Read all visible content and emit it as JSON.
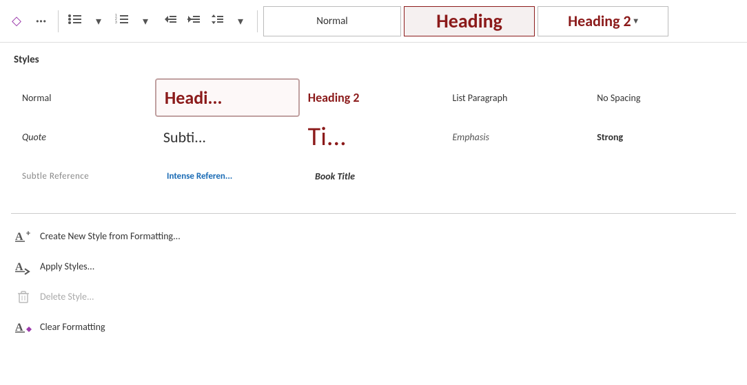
{
  "toolbar": {
    "diamond_icon": "◇",
    "more_icon": "•••",
    "bullet_list_icon": "≡",
    "num_list_icon": "≡",
    "outdent_icon": "⇤",
    "indent_icon": "⇥",
    "line_spacing_icon": "≡",
    "normal_label": "Normal",
    "heading1_label": "Heading",
    "heading2_label": "Heading 2",
    "dropdown_arrow": "▾"
  },
  "panel": {
    "title": "Styles",
    "styles": [
      {
        "id": "normal",
        "label": "Normal",
        "class": "sn-normal"
      },
      {
        "id": "heading1",
        "label": "Headi...",
        "class": "sn-heading1",
        "selected": true
      },
      {
        "id": "heading2",
        "label": "Heading 2",
        "class": "sn-heading2"
      },
      {
        "id": "list-paragraph",
        "label": "List Paragraph",
        "class": "sn-list-paragraph"
      },
      {
        "id": "no-spacing",
        "label": "No Spacing",
        "class": "sn-no-spacing"
      },
      {
        "id": "quote",
        "label": "Quote",
        "class": "sn-quote"
      },
      {
        "id": "subtitle",
        "label": "Subti...",
        "class": "sn-subtitle"
      },
      {
        "id": "title",
        "label": "Ti...",
        "class": "sn-title"
      },
      {
        "id": "emphasis",
        "label": "Emphasis",
        "class": "sn-emphasis"
      },
      {
        "id": "strong",
        "label": "Strong",
        "class": "sn-strong"
      },
      {
        "id": "subtle-ref",
        "label": "Subtle Reference",
        "class": "sn-subtle-ref"
      },
      {
        "id": "intense-ref",
        "label": "Intense Referen...",
        "class": "sn-intense-ref"
      },
      {
        "id": "book-title",
        "label": "Book Title",
        "class": "sn-book-title"
      }
    ],
    "actions": [
      {
        "id": "create-style",
        "icon": "A+",
        "label": "Create New Style from Formatting...",
        "disabled": false
      },
      {
        "id": "apply-styles",
        "icon": "A→",
        "label": "Apply Styles...",
        "disabled": false
      },
      {
        "id": "delete-style",
        "icon": "🗑",
        "label": "Delete Style...",
        "disabled": true
      },
      {
        "id": "clear-formatting",
        "icon": "A◇",
        "label": "Clear Formatting",
        "disabled": false
      }
    ]
  }
}
